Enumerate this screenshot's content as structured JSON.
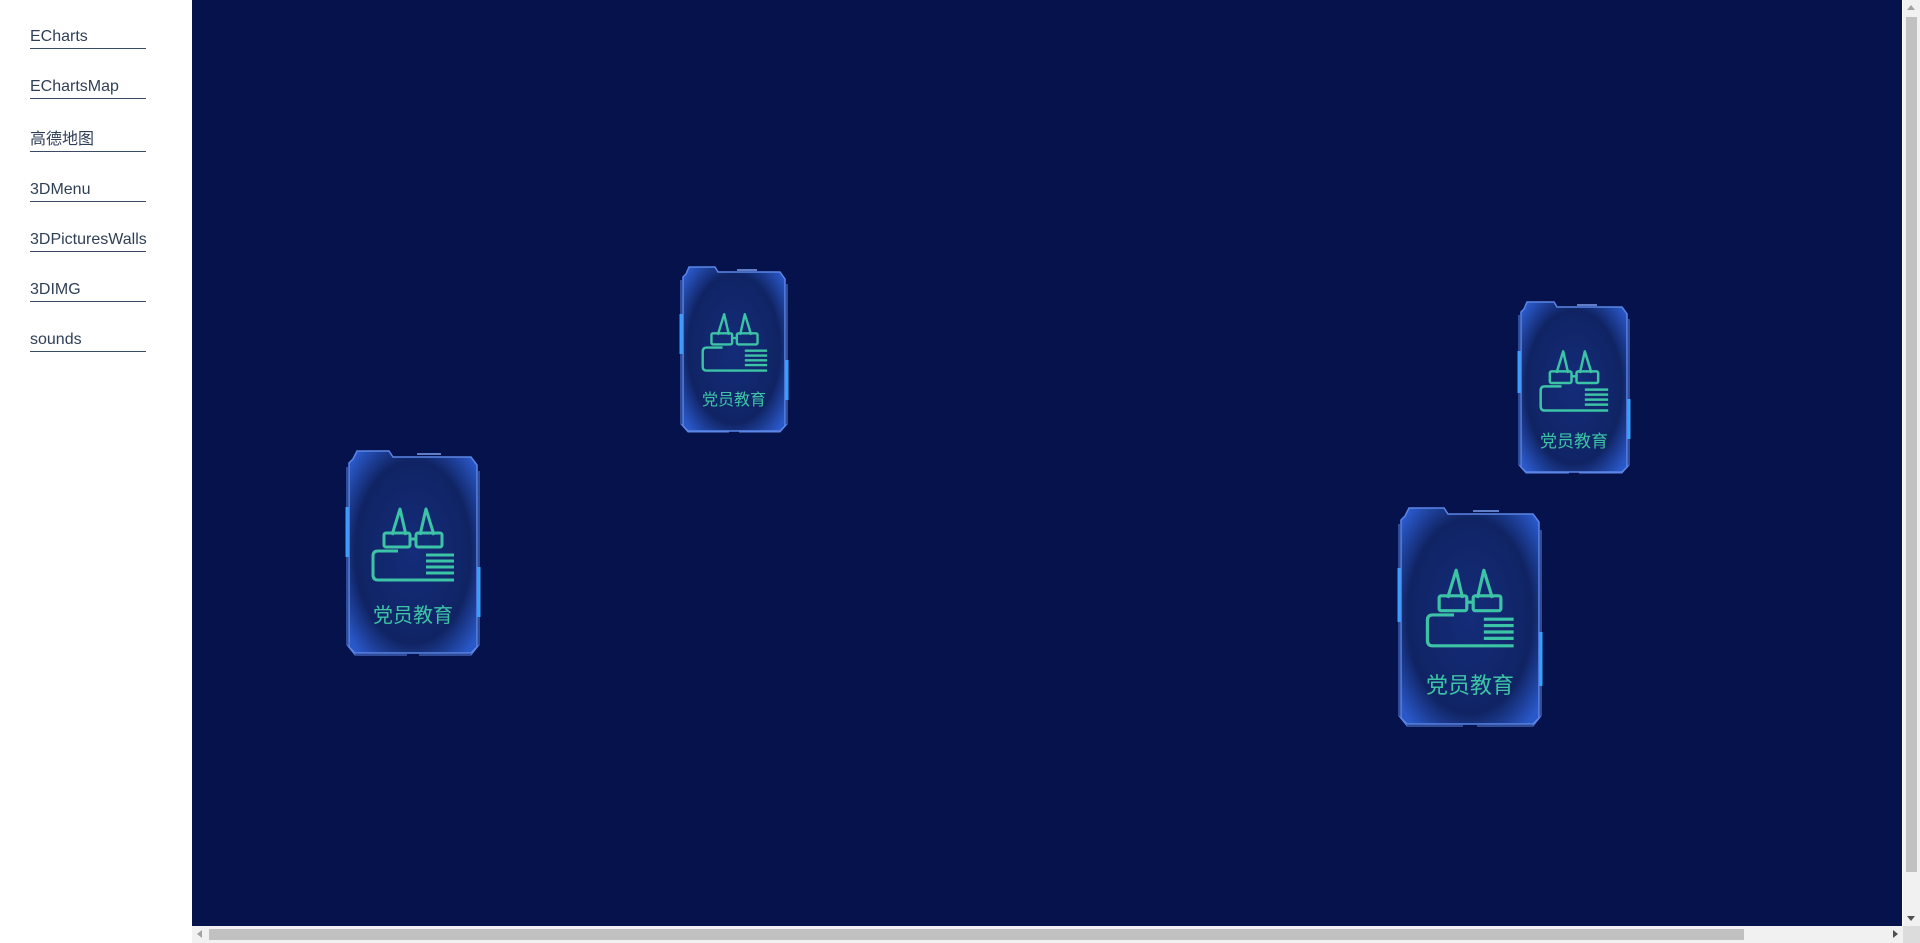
{
  "nav": {
    "items": [
      {
        "label": "ECharts"
      },
      {
        "label": "EChartsMap"
      },
      {
        "label": "高德地图"
      },
      {
        "label": "3DMenu"
      },
      {
        "label": "3DPicturesWalls"
      },
      {
        "label": "3DIMG"
      },
      {
        "label": "sounds"
      }
    ]
  },
  "stage": {
    "background": "#06124c",
    "tiles": [
      {
        "label": "党员教育",
        "icon": "glasses-book-icon"
      },
      {
        "label": "党员教育",
        "icon": "glasses-book-icon"
      },
      {
        "label": "党员教育",
        "icon": "glasses-book-icon"
      },
      {
        "label": "党员教育",
        "icon": "glasses-book-icon"
      }
    ]
  },
  "colors": {
    "accent": "#3dc3a6",
    "frame": "#4d78d8",
    "glow": "#1e90ff"
  }
}
